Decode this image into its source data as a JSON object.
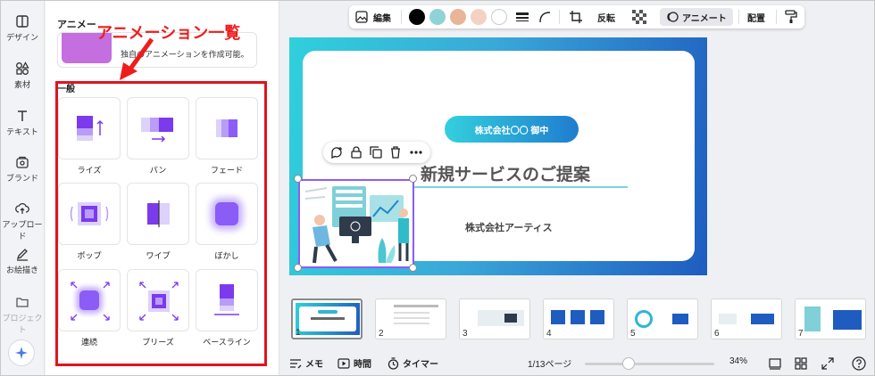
{
  "rail": {
    "items": [
      {
        "label": "デザイン",
        "icon": "design-icon"
      },
      {
        "label": "素材",
        "icon": "elements-icon"
      },
      {
        "label": "テキスト",
        "icon": "text-icon"
      },
      {
        "label": "ブランド",
        "icon": "brand-icon"
      },
      {
        "label": "アップロード",
        "icon": "upload-icon"
      },
      {
        "label": "お絵描き",
        "icon": "draw-icon"
      },
      {
        "label": "プロジェクト",
        "icon": "folder-icon"
      }
    ]
  },
  "panel": {
    "title": "アニメー",
    "promo_text": "独自のアニメーションを作成可能。",
    "section_label": "一般",
    "tiles": [
      {
        "label": "ライズ"
      },
      {
        "label": "パン"
      },
      {
        "label": "フェード"
      },
      {
        "label": "ポップ"
      },
      {
        "label": "ワイプ"
      },
      {
        "label": "ぼかし"
      },
      {
        "label": "連続"
      },
      {
        "label": "ブリーズ"
      },
      {
        "label": "ベースライン"
      }
    ]
  },
  "annotation": "アニメーション一覧",
  "toolbar": {
    "edit": "編集",
    "flip": "反転",
    "animate": "アニメート",
    "position": "配置",
    "swatches": [
      "#000000",
      "#8fd3d6",
      "#e9b497",
      "#f3d2c4",
      "#ffffff"
    ]
  },
  "slide": {
    "pill": "株式会社〇〇 御中",
    "title": "新規サービスのご提案",
    "company": "株式会社アーティス"
  },
  "filmstrip": {
    "numbers": [
      "1",
      "2",
      "3",
      "4",
      "5",
      "6",
      "7"
    ]
  },
  "bottom": {
    "memo": "メモ",
    "time": "時間",
    "timer": "タイマー",
    "page": "1/13ページ",
    "zoom": "34%"
  }
}
